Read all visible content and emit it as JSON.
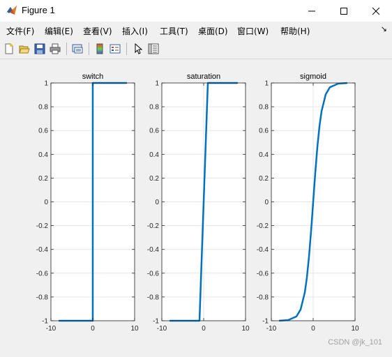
{
  "window": {
    "title": "Figure 1"
  },
  "menu": [
    "文件(F)",
    "编辑(E)",
    "查看(V)",
    "插入(I)",
    "工具(T)",
    "桌面(D)",
    "窗口(W)",
    "帮助(H)"
  ],
  "toolbar_icons": [
    "new-figure-icon",
    "open-file-icon",
    "save-icon",
    "print-icon",
    "link-plot-icon",
    "insert-colorbar-icon",
    "insert-legend-icon",
    "edit-plot-icon",
    "property-inspector-icon"
  ],
  "axes": {
    "x_ticks": [
      "-10",
      "0",
      "10"
    ],
    "y_ticks": [
      "1",
      "0.8",
      "0.6",
      "0.4",
      "0.2",
      "0",
      "-0.2",
      "-0.4",
      "-0.6",
      "-0.8",
      "-1"
    ]
  },
  "chart_data": [
    {
      "type": "line",
      "title": "switch",
      "xlim": [
        -10,
        10
      ],
      "ylim": [
        -1,
        1
      ],
      "grid": true,
      "color": "#0072bd",
      "series": [
        {
          "x": [
            -8,
            0,
            0,
            8
          ],
          "y": [
            -1,
            -1,
            1,
            1
          ]
        }
      ]
    },
    {
      "type": "line",
      "title": "saturation",
      "xlim": [
        -10,
        10
      ],
      "ylim": [
        -1,
        1
      ],
      "grid": true,
      "color": "#0072bd",
      "series": [
        {
          "x": [
            -8,
            -1,
            1,
            8
          ],
          "y": [
            -1,
            -1,
            1,
            1
          ]
        }
      ]
    },
    {
      "type": "line",
      "title": "sigmoid",
      "xlim": [
        -10,
        10
      ],
      "ylim": [
        -1,
        1
      ],
      "grid": true,
      "color": "#0072bd",
      "series": [
        {
          "x": [
            -8,
            -6,
            -4,
            -3,
            -2,
            -1.5,
            -1,
            -0.5,
            0,
            0.5,
            1,
            1.5,
            2,
            3,
            4,
            6,
            8
          ],
          "y": [
            -0.9993,
            -0.995,
            -0.964,
            -0.905,
            -0.762,
            -0.635,
            -0.462,
            -0.245,
            0,
            0.245,
            0.462,
            0.635,
            0.762,
            0.905,
            0.964,
            0.995,
            0.9993
          ]
        }
      ]
    }
  ],
  "watermark": "CSDN @jk_101"
}
